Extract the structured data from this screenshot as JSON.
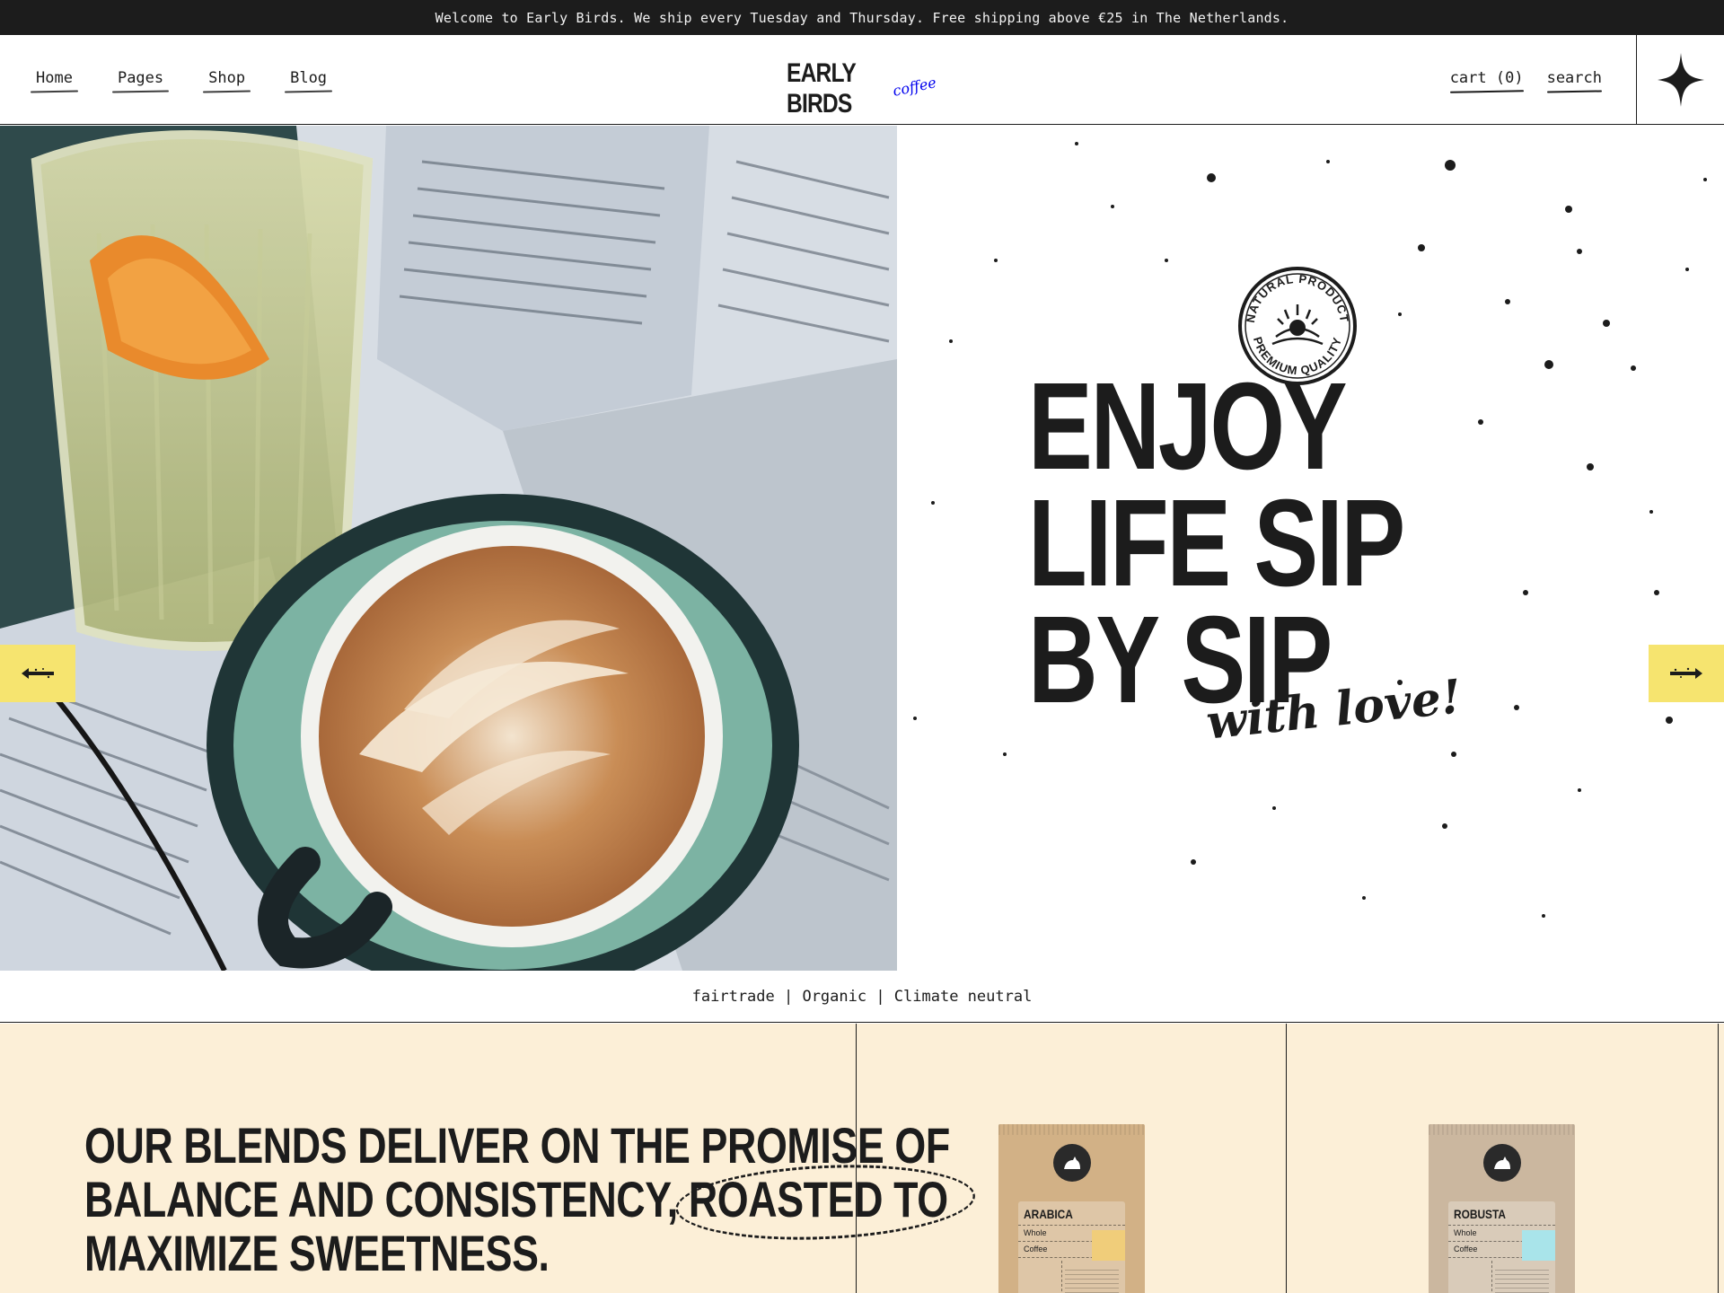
{
  "announcement": "Welcome to Early Birds. We ship every Tuesday and Thursday. Free shipping above €25 in The Netherlands.",
  "nav": {
    "items": [
      "Home",
      "Pages",
      "Shop",
      "Blog"
    ]
  },
  "logo": {
    "main": "EARLY BIRDS",
    "sub": "coffee"
  },
  "header_right": {
    "cart": "cart (0)",
    "search": "search"
  },
  "hero": {
    "headline_lines": [
      "ENJOY",
      "LIFE SIP",
      "BY SIP"
    ],
    "script": "with love!",
    "badge": {
      "top": "NATURAL PRODUCT",
      "bottom": "PREMIUM QUALITY"
    }
  },
  "features": "fairtrade | Organic | Climate neutral",
  "blends": {
    "line1": "OUR BLENDS DELIVER ON THE PROMISE OF",
    "line2_a": "BALANCE AND CONSISTENCY, ",
    "line2_b": "ROASTED TO",
    "line3": "MAXIMIZE SWEETNESS."
  },
  "products": [
    {
      "name": "ARABICA",
      "line1": "Whole",
      "line2": "Coffee",
      "bag_color": "#d2b186",
      "swatch_color": "#f0cd7a"
    },
    {
      "name": "ROBUSTA",
      "line1": "Whole",
      "line2": "Coffee",
      "bag_color": "#cbb79f",
      "swatch_color": "#a9e4ea"
    }
  ],
  "colors": {
    "dark": "#1c1c1c",
    "accent_yellow": "#f6e46f",
    "cream": "#fcefd7"
  },
  "icons": {
    "spark": "four-point-star-icon",
    "arrow_left": "bird-arrow-left-icon",
    "arrow_right": "bird-arrow-right-icon"
  }
}
